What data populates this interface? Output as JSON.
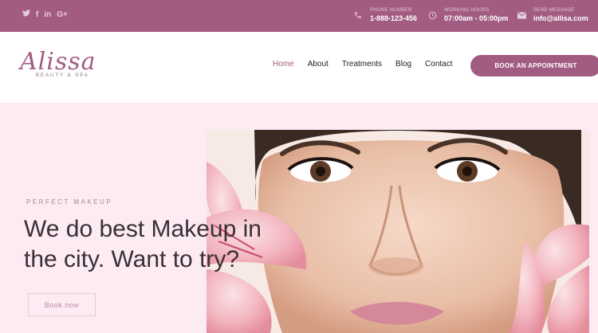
{
  "topbar": {
    "socials": [
      {
        "name": "twitter-icon",
        "glyph": "🐦"
      },
      {
        "name": "facebook-icon",
        "glyph": "f"
      },
      {
        "name": "linkedin-icon",
        "glyph": "in"
      },
      {
        "name": "google-plus-icon",
        "glyph": "G+"
      }
    ],
    "phone": {
      "label": "PHONE NUMBER",
      "value": "1-888-123-456"
    },
    "hours": {
      "label": "WORKING HOURS",
      "value": "07:00am - 05:00pm"
    },
    "message": {
      "label": "SEND MESSAGE",
      "value": "info@allisa.com"
    }
  },
  "logo": {
    "name": "Alissa",
    "sub": "BEAUTY & SPA"
  },
  "nav": {
    "items": [
      "Home",
      "About",
      "Treatments",
      "Blog",
      "Contact"
    ],
    "active": "Home"
  },
  "cta": {
    "label": "BOOK AN APPOINTMENT"
  },
  "hero": {
    "eyebrow": "PERFECT MAKEUP",
    "headline": "We do best Makeup in the city. Want to try?",
    "button": "Book now"
  },
  "colors": {
    "accent": "#a25c82",
    "hero_bg": "#fcebf3"
  }
}
